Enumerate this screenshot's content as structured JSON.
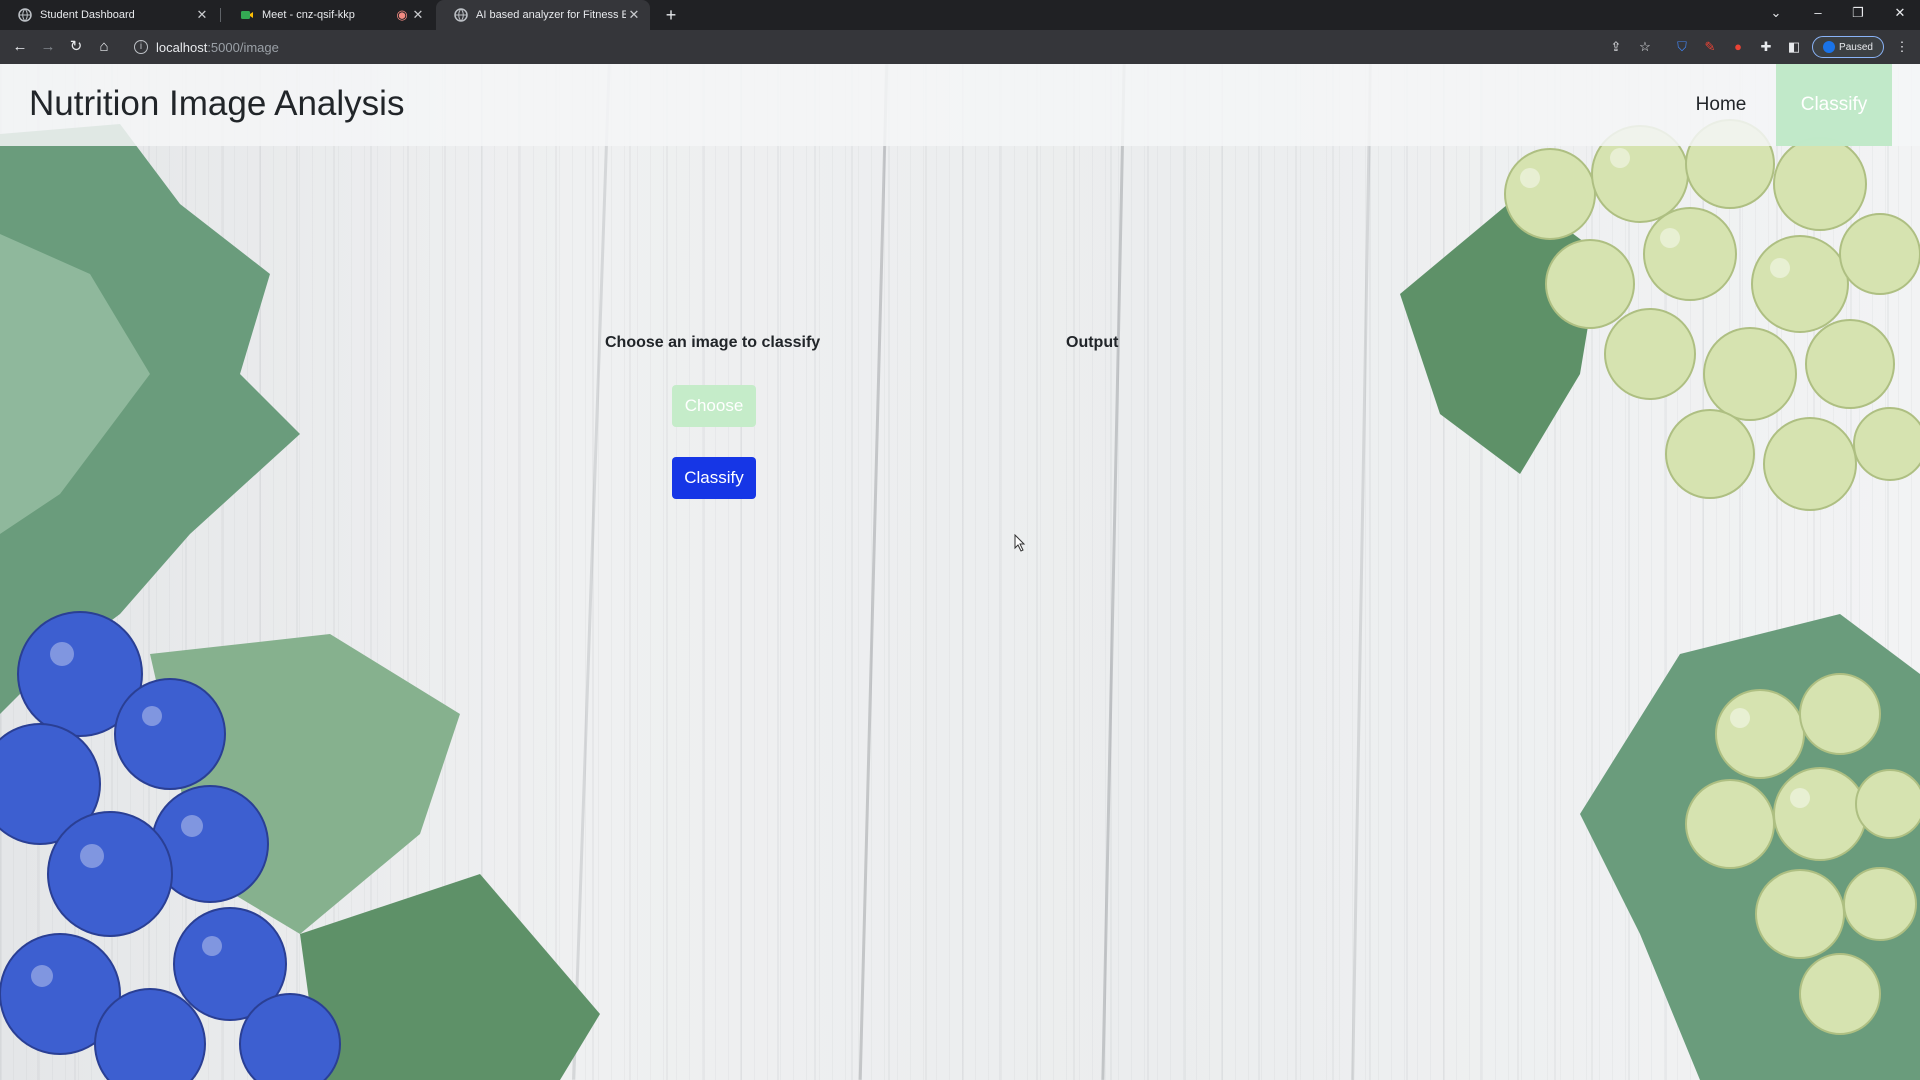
{
  "browser": {
    "tabs": [
      {
        "title": "Student Dashboard",
        "icon": "globe-icon",
        "active": false
      },
      {
        "title": "Meet - cnz-qsif-kkp",
        "icon": "meet-icon",
        "active": false
      },
      {
        "title": "AI based analyzer for Fitness Ent",
        "icon": "globe-icon",
        "active": true
      }
    ],
    "url_host": "localhost",
    "url_path": ":5000/image",
    "profile_label": "Paused"
  },
  "page": {
    "brand": "Nutrition Image Analysis",
    "nav": {
      "home": "Home",
      "classify": "Classify"
    },
    "upload_title": "Choose an image to classify",
    "output_title": "Output",
    "choose_button": "Choose",
    "classify_button": "Classify"
  },
  "colors": {
    "accent_green": "#c5ecc9",
    "primary_blue": "#1636e6",
    "chrome_dark": "#202124",
    "chrome_toolbar": "#35363a"
  }
}
